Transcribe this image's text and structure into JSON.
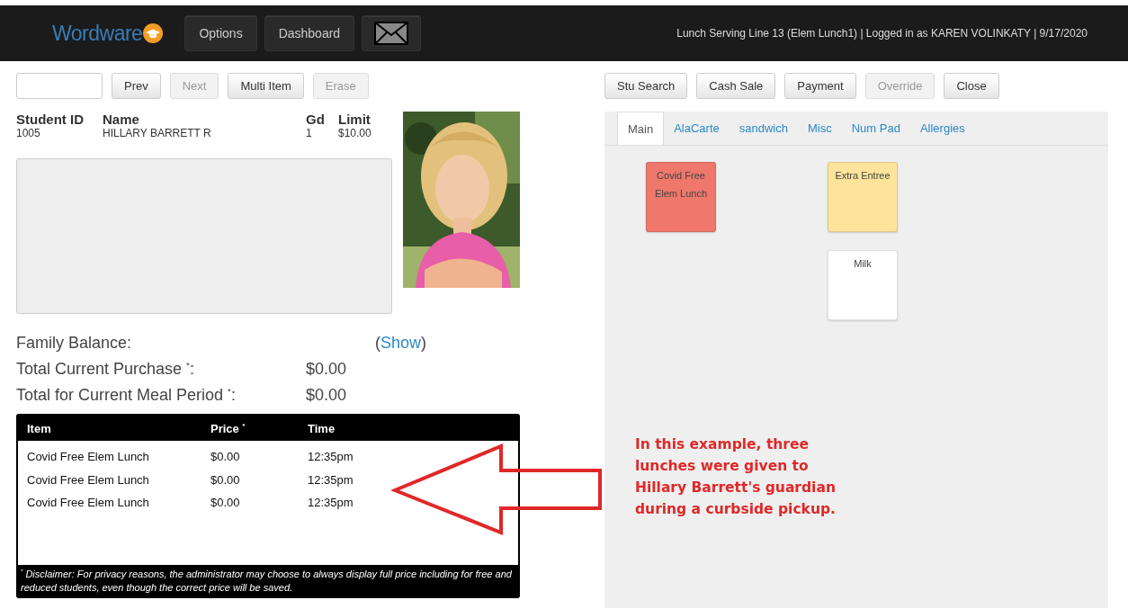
{
  "navbar": {
    "brand": "Wordware",
    "buttons": [
      "Options",
      "Dashboard"
    ],
    "status": "Lunch Serving Line 13 (Elem Lunch1) | Logged in as KAREN VOLINKATY | 9/17/2020"
  },
  "left_toolbar": {
    "buttons": [
      {
        "label": "Prev",
        "disabled": false
      },
      {
        "label": "Next",
        "disabled": true
      },
      {
        "label": "Multi Item",
        "disabled": false
      },
      {
        "label": "Erase",
        "disabled": true
      }
    ]
  },
  "student": {
    "headers": [
      "Student ID",
      "Name",
      "Gd",
      "Limit"
    ],
    "values": [
      "1005",
      "HILLARY BARRETT R",
      "1",
      "$10.00"
    ],
    "photo": {
      "kind": "picture"
    }
  },
  "totals": [
    {
      "label": "Family Balance:",
      "link": "Show",
      "link_before": "(",
      "link_after": ")"
    },
    {
      "label": "Total Current Purchase $^{*}$:",
      "value": "$0.00"
    },
    {
      "label": "Total for Current Meal Period $^{*}$:",
      "value": "$0.00"
    }
  ],
  "table": {
    "columns": [
      "Item",
      "Price $^{*}$",
      "Time"
    ],
    "rows": [
      [
        "Covid Free Elem Lunch",
        "$0.00",
        "12:35pm"
      ],
      [
        "Covid Free Elem Lunch",
        "$0.00",
        "12:35pm"
      ],
      [
        "Covid Free Elem Lunch",
        "$0.00",
        "12:35pm"
      ]
    ],
    "disclaimer": "$^{*}$ Disclaimer: For privacy reasons, the administrator may choose to always display full price including for free and reduced students, even though the correct price will be saved."
  },
  "right_toolbar": {
    "buttons": [
      {
        "label": "Stu Search",
        "disabled": false
      },
      {
        "label": "Cash Sale",
        "disabled": false
      },
      {
        "label": "Payment",
        "disabled": false
      },
      {
        "label": "Override",
        "disabled": true
      },
      {
        "label": "Close",
        "disabled": false
      }
    ]
  },
  "tabs": [
    {
      "label": "Main",
      "selected": true
    },
    {
      "label": "AlaCarte",
      "selected": false
    },
    {
      "label": "sandwich",
      "selected": false
    },
    {
      "label": "Misc",
      "selected": false
    },
    {
      "label": "Num Pad",
      "selected": false
    },
    {
      "label": "Allergies",
      "selected": false
    }
  ],
  "menu_items": [
    {
      "label": "Covid Free Elem Lunch",
      "color": "#f0776c"
    },
    {
      "label": "Extra Entree",
      "color": "#fde49a"
    },
    {
      "label": "Milk",
      "color": "#ffffff"
    }
  ],
  "annotation": "In this example, three lunches were given to Hillary Barrett's guardian during a curbside pickup."
}
